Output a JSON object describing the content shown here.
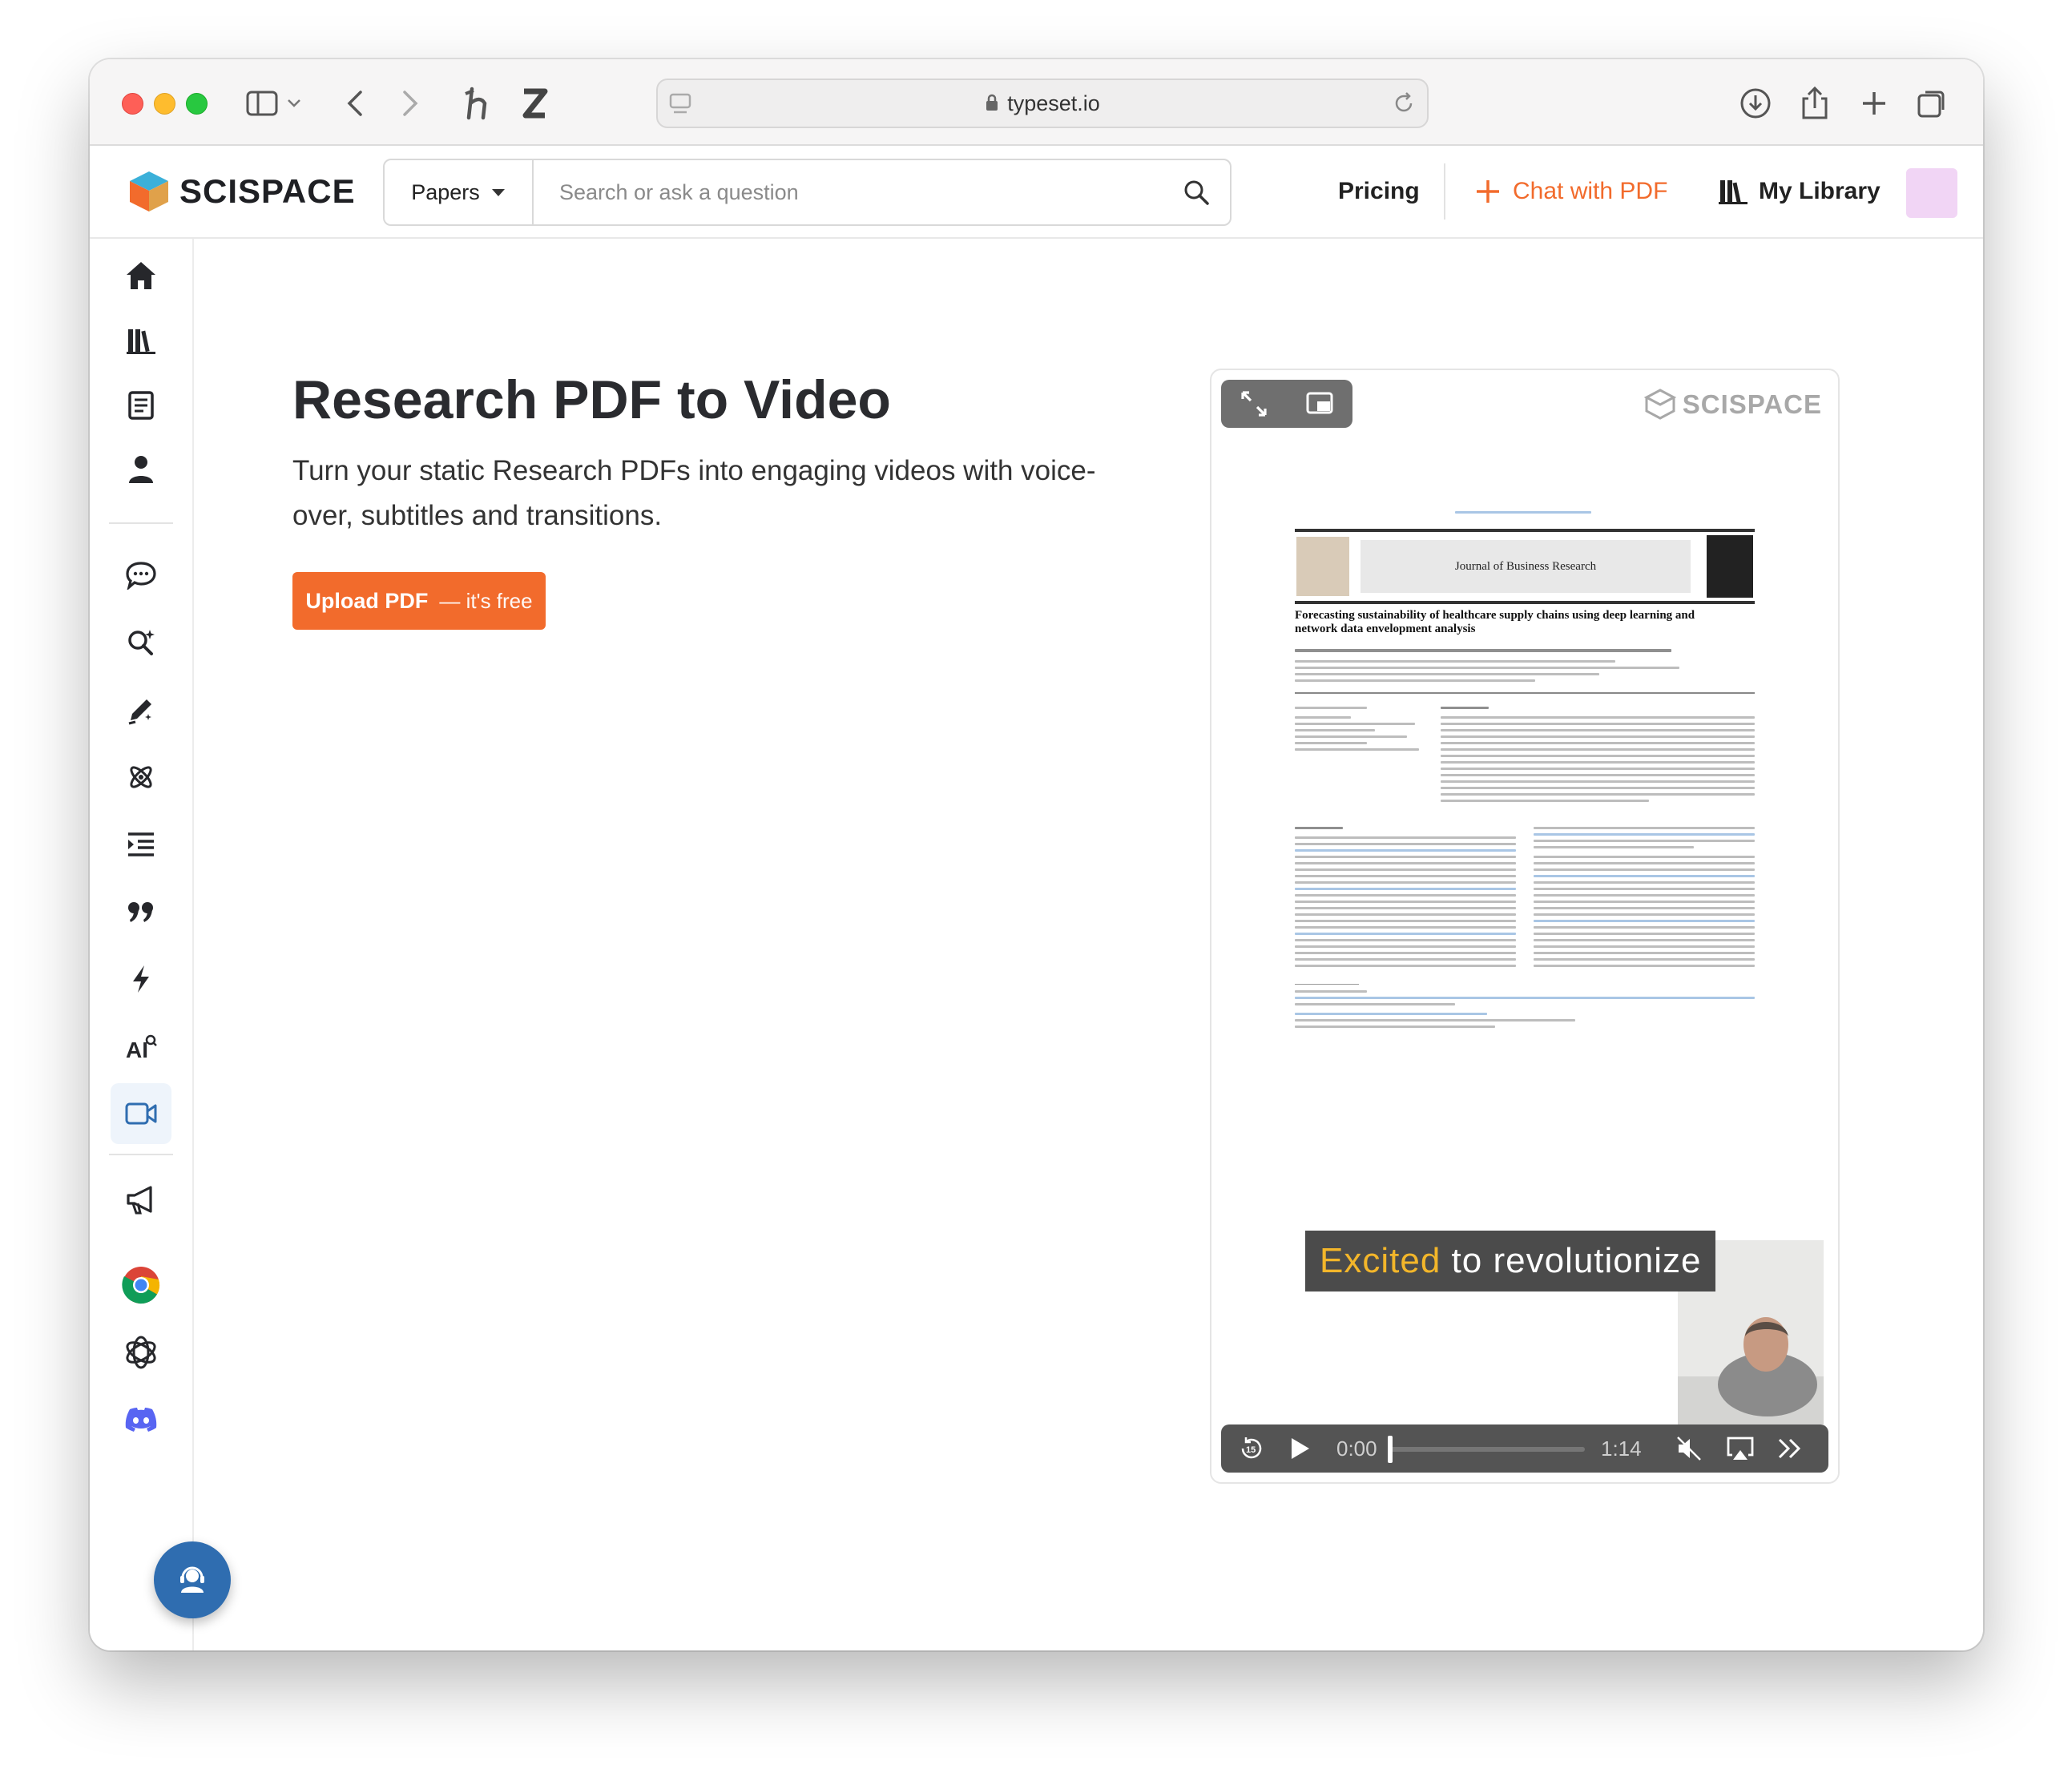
{
  "browser": {
    "url": "typeset.io"
  },
  "header": {
    "logo_text": "SCISPACE",
    "search_type": "Papers",
    "search_placeholder": "Search or ask a question",
    "pricing": "Pricing",
    "chat_pdf": "Chat with PDF",
    "my_library": "My Library",
    "accent_color": "#f26b2c"
  },
  "sidebar": {
    "items": [
      {
        "name": "home"
      },
      {
        "name": "library"
      },
      {
        "name": "notebook"
      },
      {
        "name": "profile"
      },
      {
        "name": "chat"
      },
      {
        "name": "search-ai"
      },
      {
        "name": "write"
      },
      {
        "name": "integrations"
      },
      {
        "name": "outline"
      },
      {
        "name": "citation"
      },
      {
        "name": "quick-actions"
      },
      {
        "name": "ai-detector"
      },
      {
        "name": "video",
        "active": true
      },
      {
        "name": "announcements"
      },
      {
        "name": "chrome-extension"
      },
      {
        "name": "chatgpt"
      },
      {
        "name": "discord"
      }
    ]
  },
  "main": {
    "title": "Research PDF to Video",
    "subtitle": "Turn your static Research PDFs into engaging videos with voice-over, subtitles and transitions.",
    "upload_label": "Upload PDF",
    "upload_sub": "— it's free"
  },
  "video": {
    "watermark": "SCISPACE",
    "pdf_journal": "Journal of Business Research",
    "pdf_title": "Forecasting sustainability of healthcare supply chains using deep learning and network data envelopment analysis",
    "caption_highlight": "Excited",
    "caption_rest": "to revolutionize",
    "current_time": "0:00",
    "duration": "1:14",
    "progress": 0.0
  }
}
